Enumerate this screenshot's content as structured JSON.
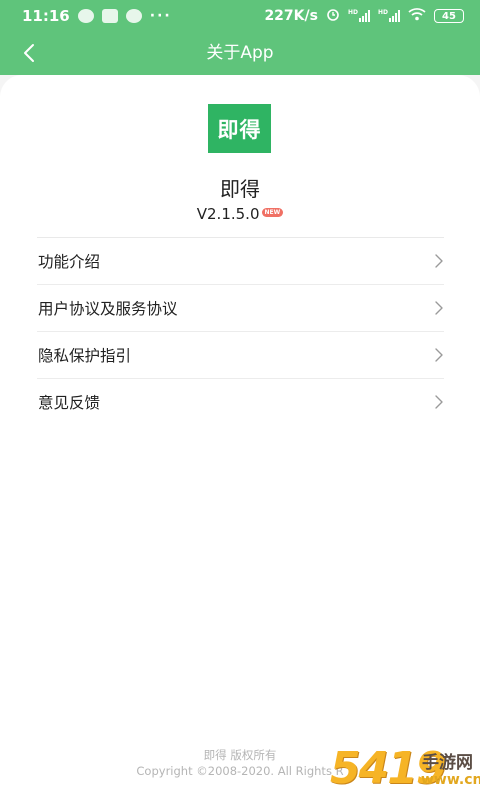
{
  "status_bar": {
    "time": "11:16",
    "more": "···",
    "net_speed": "227K/s",
    "signal_1_tag": "HD",
    "signal_2_tag": "HD",
    "battery": "45"
  },
  "app_bar": {
    "back_icon": "chevron-left-icon",
    "title": "关于App"
  },
  "app_info": {
    "logo_text": "即得",
    "name": "即得",
    "version": "V2.1.5.0",
    "new_badge": "NEW"
  },
  "menu": {
    "items": [
      {
        "label": "功能介绍",
        "icon": "chevron-right-icon"
      },
      {
        "label": "用户协议及服务协议",
        "icon": "chevron-right-icon"
      },
      {
        "label": "隐私保护指引",
        "icon": "chevron-right-icon"
      },
      {
        "label": "意见反馈",
        "icon": "chevron-right-icon"
      }
    ]
  },
  "footer": {
    "owner": "即得 版权所有",
    "copyright": "Copyright ©2008-2020. All Rights R"
  },
  "watermark": {
    "number": "5419",
    "name": "手游网",
    "site": "www.cn"
  },
  "colors": {
    "header_green": "#5fc47b",
    "logo_green": "#2fb463",
    "badge_red": "#f07064"
  }
}
